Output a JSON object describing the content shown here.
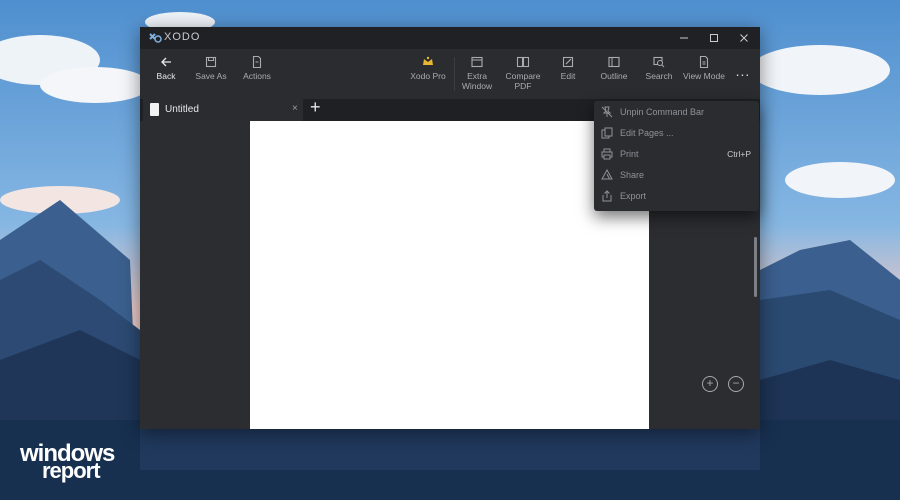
{
  "window": {
    "title": "XODO"
  },
  "toolbar": {
    "back_label": "Back",
    "save_as_label": "Save As",
    "actions_label": "Actions",
    "xodo_pro_label": "Xodo Pro",
    "extra_window_label": "Extra Window",
    "compare_pdf_label": "Compare PDF",
    "edit_label": "Edit",
    "outline_label": "Outline",
    "search_label": "Search",
    "view_mode_label": "View Mode",
    "more_label": "..."
  },
  "tabs": [
    {
      "label": "Untitled",
      "close": "×"
    }
  ],
  "tab_add": "+",
  "menu": {
    "items": [
      {
        "label": "Unpin Command Bar",
        "shortcut": "",
        "icon": "unpin-icon"
      },
      {
        "label": "Edit Pages ...",
        "shortcut": "",
        "icon": "edit-pages-icon"
      },
      {
        "label": "Print",
        "shortcut": "Ctrl+P",
        "icon": "print-icon"
      },
      {
        "label": "Share",
        "shortcut": "",
        "icon": "share-icon"
      },
      {
        "label": "Export",
        "shortcut": "",
        "icon": "export-icon"
      }
    ]
  },
  "zoom": {
    "in": "+",
    "out": "−"
  },
  "watermark": {
    "line1": "windows",
    "line2": "report"
  },
  "colors": {
    "window_bg": "#2b2c30",
    "titlebar_bg": "#202124",
    "accent_gold": "#e8b632",
    "menu_bg": "#2b2c30"
  }
}
